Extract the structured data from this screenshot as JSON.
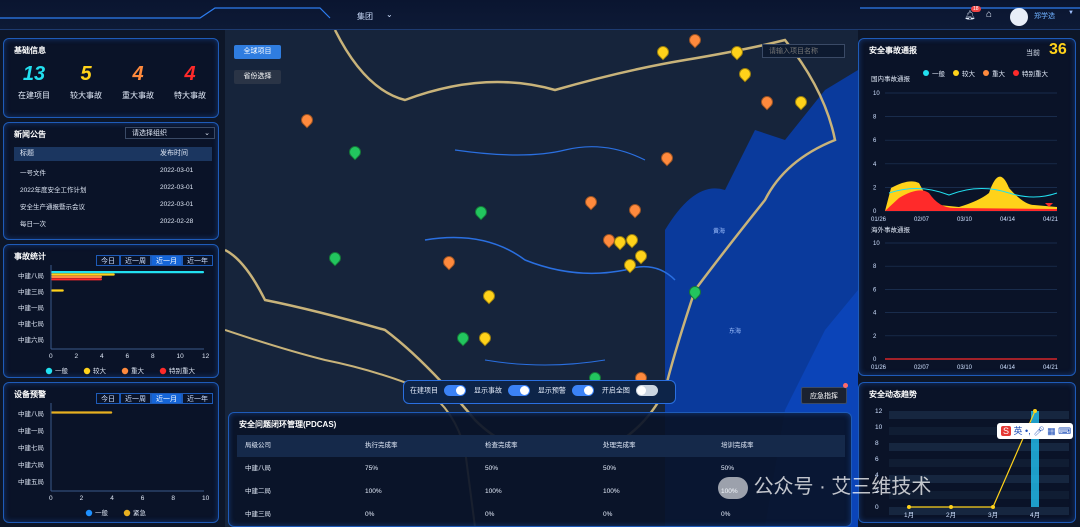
{
  "topbar": {
    "org": "集团",
    "notify_count": "18",
    "user": "郑学选"
  },
  "map": {
    "btn_global": "全球项目",
    "btn_province": "省份选择",
    "search_placeholder": "请输入项目名称",
    "emergency": "应急指挥",
    "sea_yellow": "黄海",
    "sea_east": "东海",
    "toggles": [
      {
        "label": "在建项目",
        "on": true
      },
      {
        "label": "显示事故",
        "on": true
      },
      {
        "label": "显示预警",
        "on": true
      },
      {
        "label": "开启全图",
        "on": false
      }
    ]
  },
  "basic": {
    "title": "基础信息",
    "stats": [
      {
        "value": "13",
        "label": "在建项目",
        "color": "#22e0f0"
      },
      {
        "value": "5",
        "label": "较大事故",
        "color": "#ffd21a"
      },
      {
        "value": "4",
        "label": "重大事故",
        "color": "#ff8a3d"
      },
      {
        "value": "4",
        "label": "特大事故",
        "color": "#ff2a2a"
      }
    ]
  },
  "news": {
    "title": "新闻公告",
    "select": "请选择组织",
    "col_title": "标题",
    "col_time": "发布时间",
    "rows": [
      [
        "一号文件",
        "2022-03-01"
      ],
      [
        "2022年度安全工作计划",
        "2022-03-01"
      ],
      [
        "安全生产通报暨示会议",
        "2022-03-01"
      ],
      [
        "每日一次",
        "2022-02-28"
      ]
    ]
  },
  "accident": {
    "title": "事故统计",
    "tabs": [
      "今日",
      "近一周",
      "近一月",
      "近一年"
    ],
    "active": 2,
    "rows": [
      "中建八局",
      "中建三局",
      "中建一局",
      "中建七局",
      "中建六局"
    ],
    "xticks": [
      "0",
      "2",
      "4",
      "6",
      "8",
      "10",
      "12"
    ],
    "legend": [
      "一般",
      "较大",
      "重大",
      "特别重大"
    ]
  },
  "device": {
    "title": "设备预警",
    "tabs": [
      "今日",
      "近一周",
      "近一月",
      "近一年"
    ],
    "active": 2,
    "rows": [
      "中建八局",
      "中建一局",
      "中建七局",
      "中建六局",
      "中建五局"
    ],
    "xticks": [
      "0",
      "2",
      "4",
      "6",
      "8",
      "10"
    ],
    "legend": [
      "一般",
      "紧急"
    ]
  },
  "pdcas": {
    "title": "安全问题闭环管理(PDCAS)",
    "headers": [
      "局级公司",
      "执行完成率",
      "检查完成率",
      "处理完成率",
      "培训完成率"
    ],
    "rows": [
      [
        "中建八局",
        "75%",
        "50%",
        "50%",
        "50%"
      ],
      [
        "中建二局",
        "100%",
        "100%",
        "100%",
        "100%"
      ],
      [
        "中建三局",
        "0%",
        "0%",
        "0%",
        "0%"
      ]
    ]
  },
  "notice": {
    "title": "安全事故通报",
    "current_label": "当前",
    "current_value": "36",
    "legend": [
      "一般",
      "较大",
      "重大",
      "特别重大"
    ],
    "domestic": "国内事故通报",
    "overseas": "海外事故通报",
    "yticks": [
      "10",
      "8",
      "6",
      "4",
      "2",
      "0"
    ],
    "xticks": [
      "01/26",
      "02/07",
      "03/10",
      "04/14",
      "04/21"
    ]
  },
  "trend": {
    "title": "安全动态趋势",
    "yticks": [
      "12",
      "10",
      "8",
      "6",
      "4",
      "2",
      "0"
    ],
    "xticks": [
      "1月",
      "2月",
      "3月",
      "4月"
    ]
  },
  "watermark": {
    "text": "公众号 · 艾三维技术"
  },
  "ime": {
    "label": "英"
  },
  "chart_data": [
    {
      "type": "bar",
      "title": "事故统计",
      "categories": [
        "中建八局",
        "中建三局",
        "中建一局",
        "中建七局",
        "中建六局"
      ],
      "series": [
        {
          "name": "一般",
          "values": [
            12,
            0,
            0,
            0,
            0
          ]
        },
        {
          "name": "较大",
          "values": [
            5,
            1,
            0,
            0,
            0
          ]
        },
        {
          "name": "重大",
          "values": [
            4,
            0,
            0,
            0,
            0
          ]
        },
        {
          "name": "特别重大",
          "values": [
            4,
            0,
            0,
            0,
            0
          ]
        }
      ],
      "xlim": [
        0,
        12
      ]
    },
    {
      "type": "bar",
      "title": "设备预警",
      "categories": [
        "中建八局",
        "中建一局",
        "中建七局",
        "中建六局",
        "中建五局"
      ],
      "series": [
        {
          "name": "一般",
          "values": [
            0,
            0,
            0,
            0,
            0
          ]
        },
        {
          "name": "紧急",
          "values": [
            4,
            0,
            0,
            0,
            0
          ]
        }
      ],
      "xlim": [
        0,
        10
      ]
    },
    {
      "type": "area",
      "title": "国内事故通报",
      "x": [
        "01/26",
        "02/07",
        "03/10",
        "04/14",
        "04/21"
      ],
      "ylim": [
        0,
        10
      ]
    },
    {
      "type": "line",
      "title": "安全动态趋势",
      "x": [
        "1月",
        "2月",
        "3月",
        "4月"
      ],
      "values": [
        0,
        0,
        0,
        12
      ],
      "ylim": [
        0,
        12
      ]
    }
  ]
}
